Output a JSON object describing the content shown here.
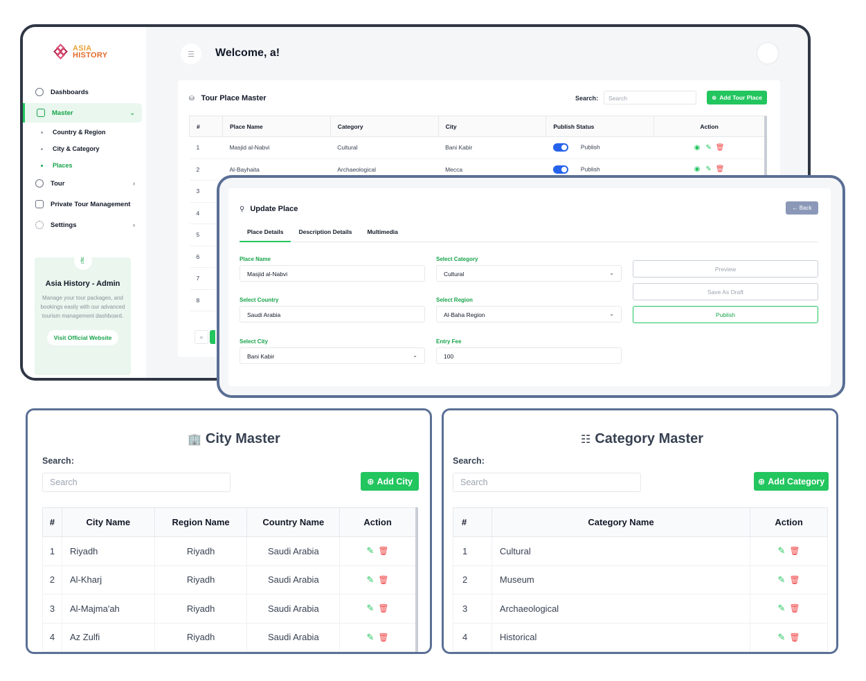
{
  "brand": {
    "line1": "ASIA",
    "line2": "HISTORY"
  },
  "sidebar": {
    "items": [
      {
        "label": "Dashboards"
      },
      {
        "label": "Master"
      },
      {
        "label": "Tour"
      },
      {
        "label": "Private Tour Management"
      },
      {
        "label": "Settings"
      }
    ],
    "subitems": [
      "Country & Region",
      "City & Category",
      "Places"
    ]
  },
  "promo": {
    "title": "Asia History - Admin",
    "text": "Manage your tour packages, and bookings easily with our advanced tourism management dashboard.",
    "button": "Visit Official Website"
  },
  "header": {
    "welcome": "Welcome, a!"
  },
  "tour_place": {
    "title": "Tour Place Master",
    "search_label": "Search:",
    "search_placeholder": "Search",
    "add_button": "Add Tour Place",
    "columns": [
      "#",
      "Place Name",
      "Category",
      "City",
      "Publish Status",
      "Action"
    ],
    "rows": [
      {
        "num": "1",
        "name": "Masjid al-Nabvi",
        "category": "Cultural",
        "city": "Bani Kabir",
        "status": "Publish"
      },
      {
        "num": "2",
        "name": "Al-Bayhaita",
        "category": "Archaeological",
        "city": "Mecca",
        "status": "Publish"
      },
      {
        "num": "3"
      },
      {
        "num": "4"
      },
      {
        "num": "5"
      },
      {
        "num": "6"
      },
      {
        "num": "7"
      },
      {
        "num": "8"
      }
    ],
    "pager_prev": "«"
  },
  "update_place": {
    "title": "Update Place",
    "back": "← Back",
    "tabs": [
      "Place Details",
      "Description Details",
      "Multimedia"
    ],
    "fields": {
      "place_name": {
        "label": "Place Name",
        "value": "Masjid al-Nabvi"
      },
      "category": {
        "label": "Select Category",
        "value": "Cultural"
      },
      "country": {
        "label": "Select Country",
        "value": "Saudi Arabia"
      },
      "region": {
        "label": "Select Region",
        "value": "Al-Baha Region"
      },
      "city": {
        "label": "Select City",
        "value": "Bani Kabir"
      },
      "fee": {
        "label": "Entry Fee",
        "value": "100"
      }
    },
    "buttons": {
      "preview": "Preview",
      "draft": "Save As Draft",
      "publish": "Publish"
    }
  },
  "city_master": {
    "title": "City Master",
    "search_label": "Search:",
    "search_placeholder": "Search",
    "add_button": "Add City",
    "columns": [
      "#",
      "City Name",
      "Region Name",
      "Country Name",
      "Action"
    ],
    "rows": [
      {
        "num": "1",
        "city": "Riyadh",
        "region": "Riyadh",
        "country": "Saudi Arabia"
      },
      {
        "num": "2",
        "city": "Al-Kharj",
        "region": "Riyadh",
        "country": "Saudi Arabia"
      },
      {
        "num": "3",
        "city": "Al-Majma'ah",
        "region": "Riyadh",
        "country": "Saudi Arabia"
      },
      {
        "num": "4",
        "city": "Az Zulfi",
        "region": "Riyadh",
        "country": "Saudi Arabia"
      }
    ]
  },
  "category_master": {
    "title": "Category Master",
    "search_label": "Search:",
    "search_placeholder": "Search",
    "add_button": "Add Category",
    "columns": [
      "#",
      "Category Name",
      "Action"
    ],
    "rows": [
      {
        "num": "1",
        "name": "Cultural"
      },
      {
        "num": "2",
        "name": "Museum"
      },
      {
        "num": "3",
        "name": "Archaeological"
      },
      {
        "num": "4",
        "name": "Historical"
      }
    ]
  }
}
